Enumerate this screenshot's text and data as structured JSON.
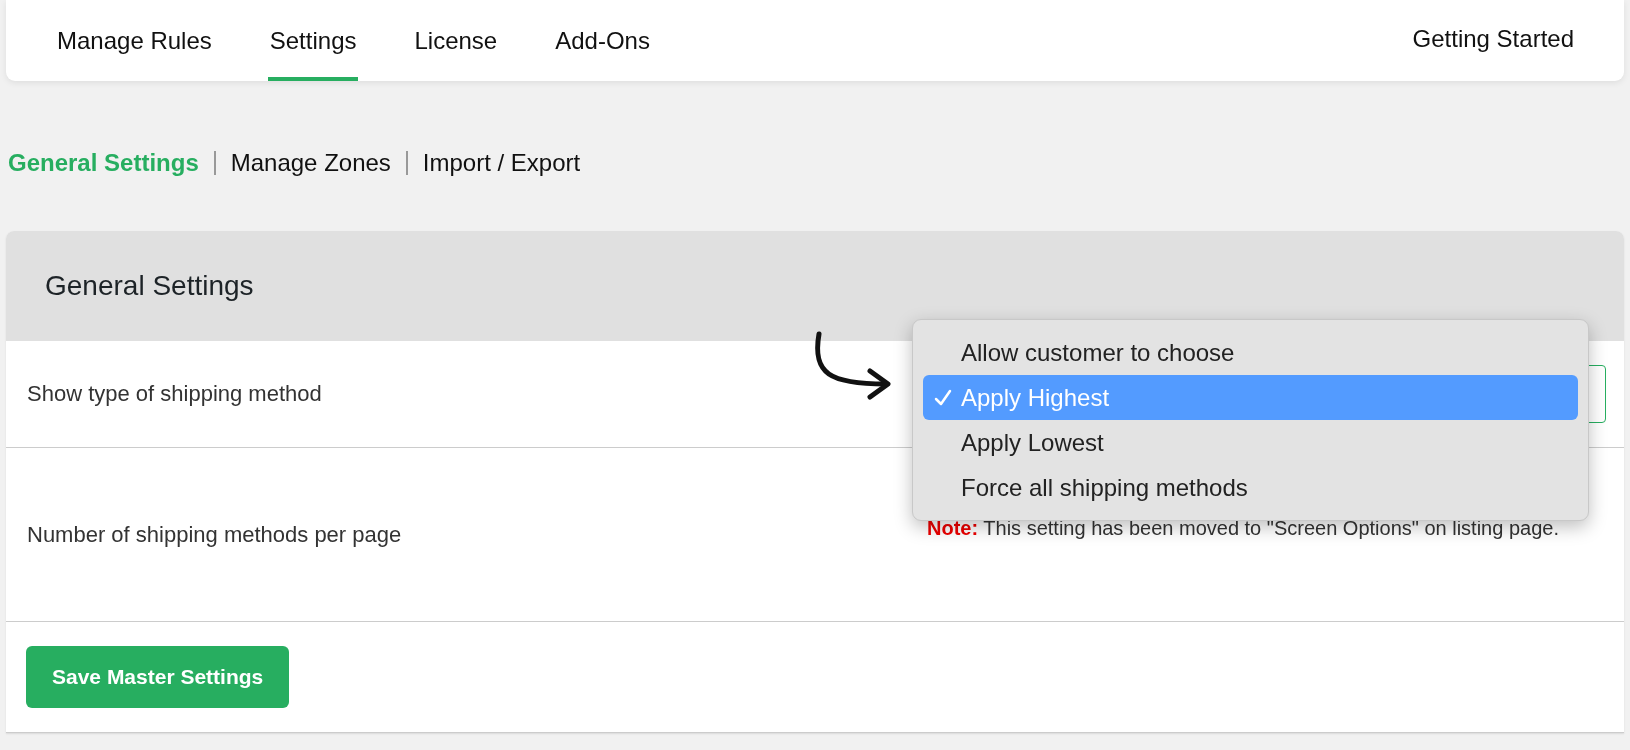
{
  "nav": {
    "tabs": [
      {
        "label": "Manage Rules",
        "selected": false
      },
      {
        "label": "Settings",
        "selected": true
      },
      {
        "label": "License",
        "selected": false
      },
      {
        "label": "Add-Ons",
        "selected": false
      }
    ],
    "right_link": "Getting Started"
  },
  "subnav": [
    {
      "label": "General Settings",
      "selected": true
    },
    {
      "label": "Manage Zones",
      "selected": false
    },
    {
      "label": "Import / Export",
      "selected": false
    }
  ],
  "panel": {
    "title": "General Settings",
    "rows": [
      {
        "kind": "select",
        "label": "Show type of shipping method",
        "dropdown": {
          "options": [
            {
              "label": "Allow customer to choose",
              "selected": false
            },
            {
              "label": "Apply Highest",
              "selected": true
            },
            {
              "label": "Apply Lowest",
              "selected": false
            },
            {
              "label": "Force all shipping methods",
              "selected": false
            }
          ]
        }
      },
      {
        "kind": "note",
        "label": "Number of shipping methods per page",
        "note_label": "Note:",
        "note_text": "This setting has been moved to \"Screen Options\" on listing page."
      }
    ],
    "save_button": "Save Master Settings"
  }
}
